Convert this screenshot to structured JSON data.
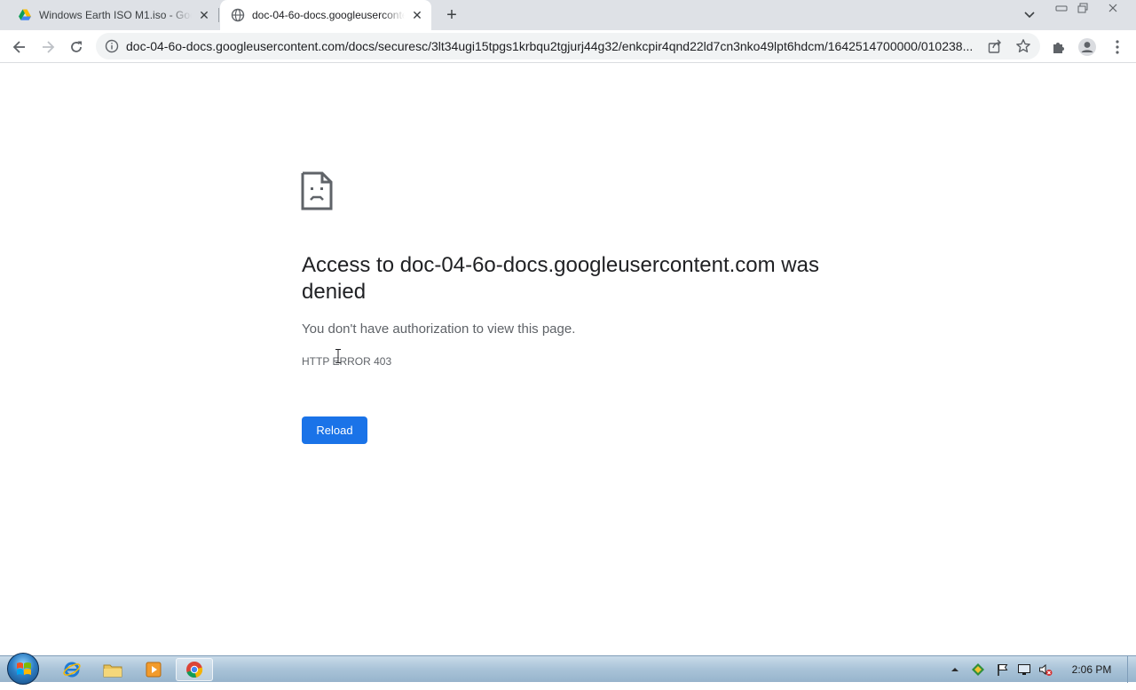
{
  "browser": {
    "tabs": [
      {
        "title": "Windows Earth ISO M1.iso - Google Drive",
        "favicon": "google-drive-icon",
        "active": false
      },
      {
        "title": "doc-04-6o-docs.googleusercontent.com",
        "favicon": "globe-icon",
        "active": true
      }
    ],
    "new_tab_symbol": "+",
    "address_bar": {
      "url": "doc-04-6o-docs.googleusercontent.com/docs/securesc/3lt34ugi15tpgs1krbqu2tgjurj44g32/enkcpir4qnd22ld7cn3nko49lpt6hdcm/1642514700000/010238..."
    }
  },
  "error_page": {
    "heading": "Access to doc-04-6o-docs.googleusercontent.com was denied",
    "description": "You don't have authorization to view this page.",
    "error_code": "HTTP ERROR 403",
    "reload_label": "Reload"
  },
  "taskbar": {
    "pinned": [
      "internet-explorer-icon",
      "windows-explorer-icon",
      "media-player-icon",
      "chrome-icon"
    ],
    "clock": "2:06 PM"
  },
  "colors": {
    "accent_blue": "#1a73e8",
    "tab_strip": "#dee1e6",
    "omnibox_bg": "#f1f3f4"
  }
}
